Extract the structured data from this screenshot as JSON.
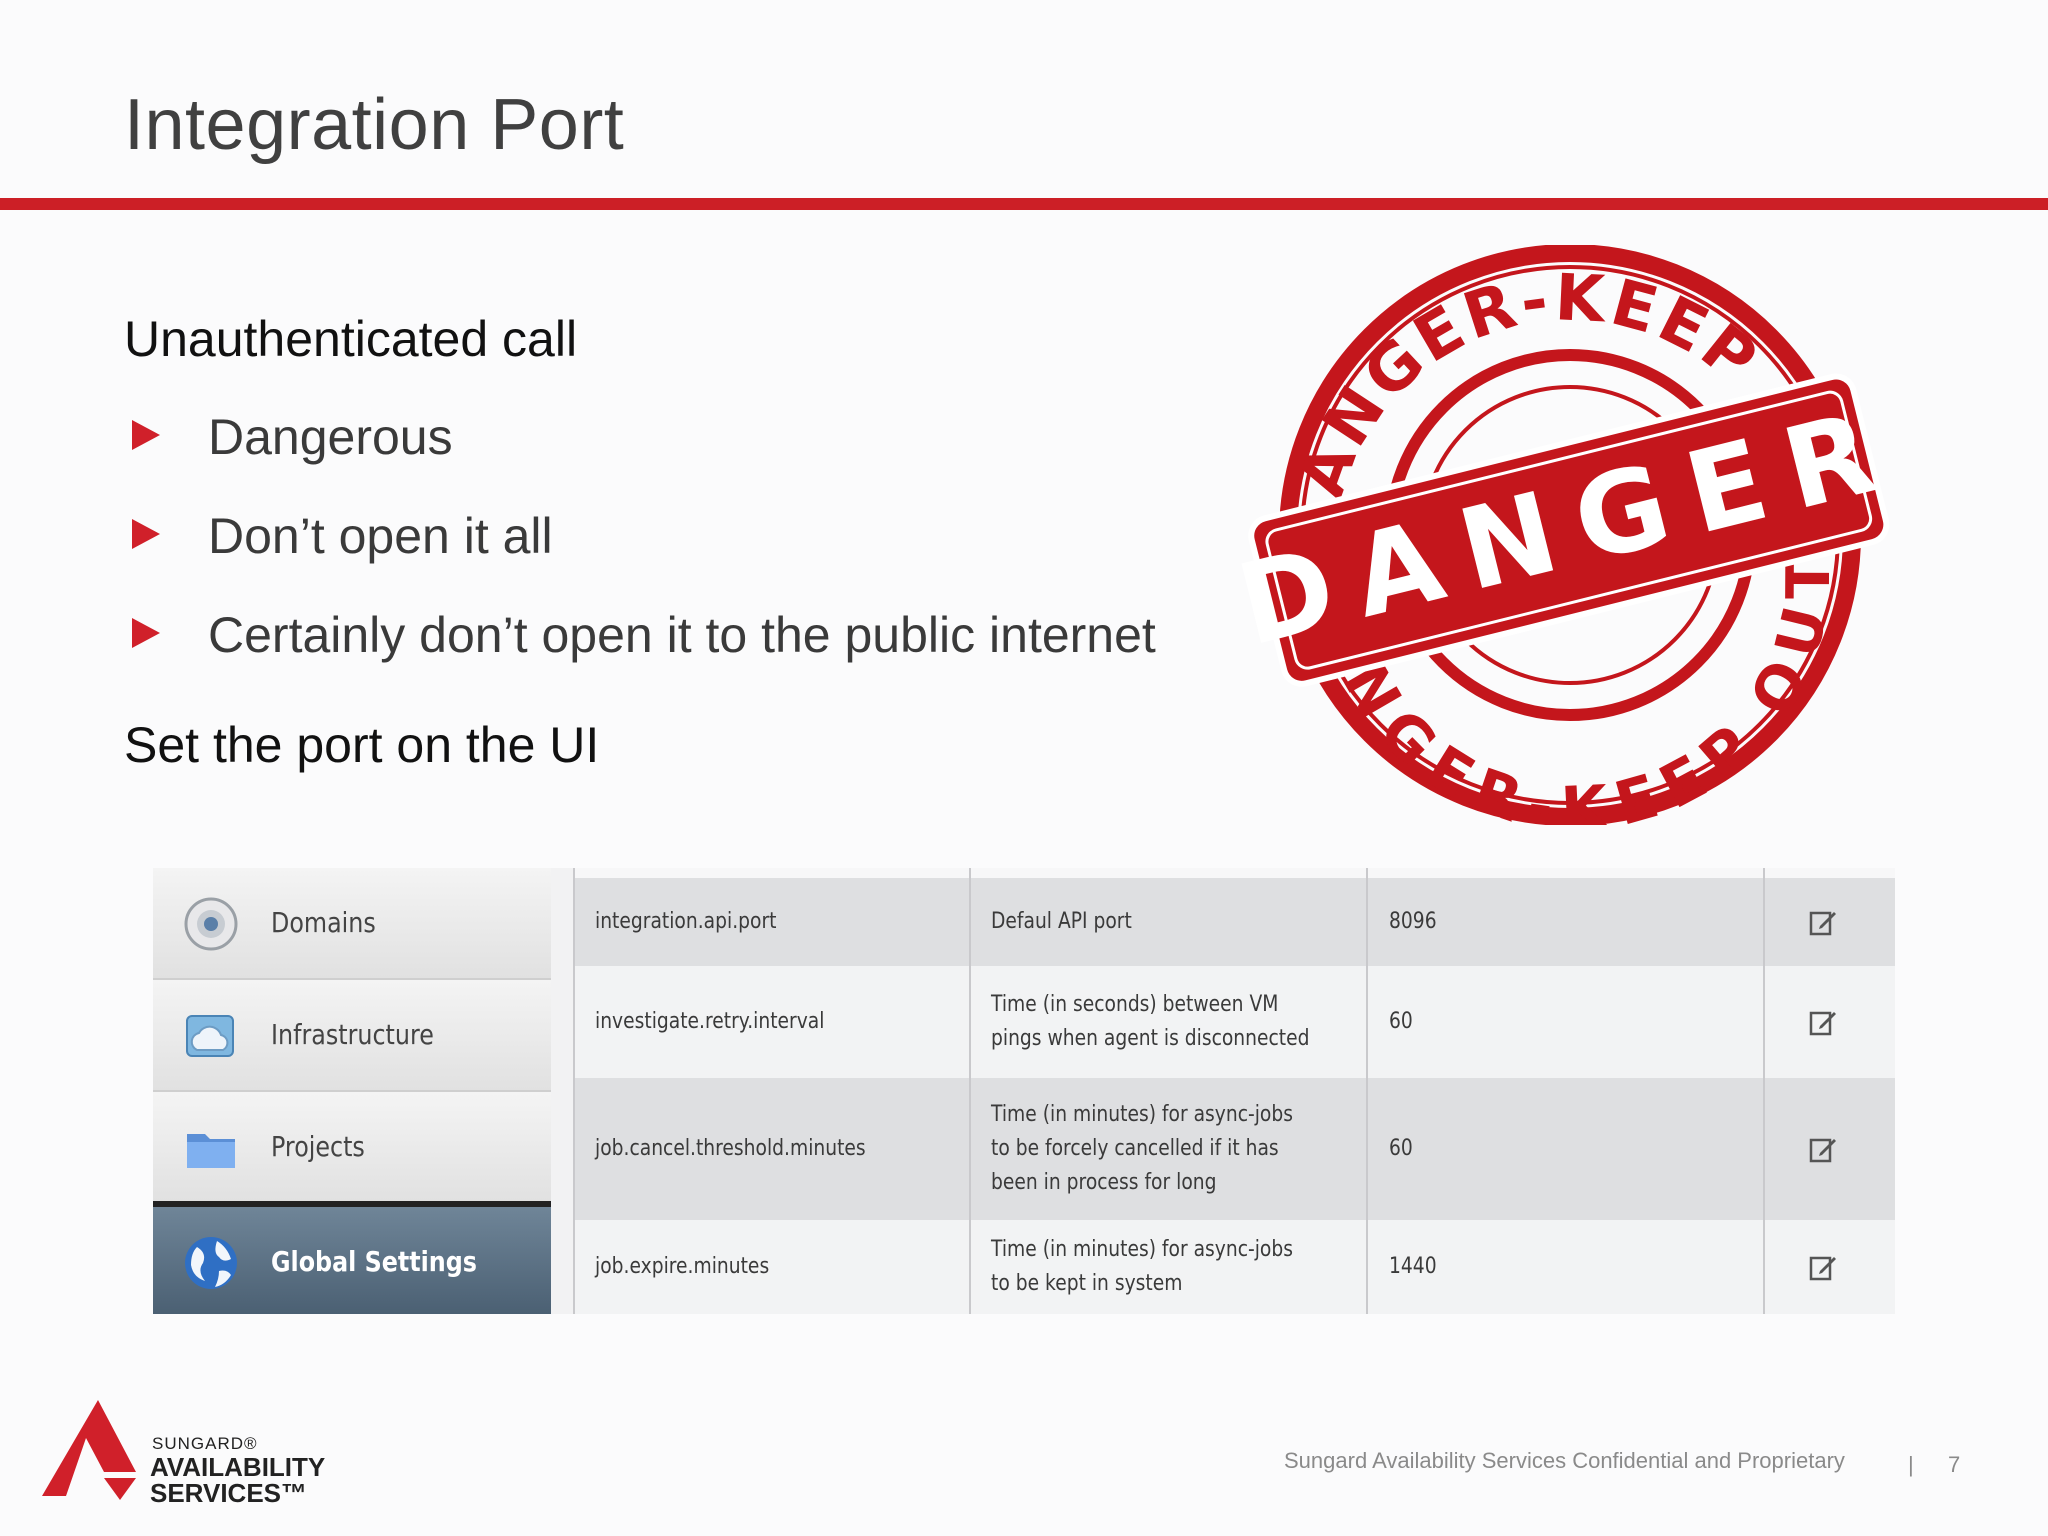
{
  "slide": {
    "title": "Integration Port",
    "heading1": "Unauthenticated call",
    "bullets": [
      "Dangerous",
      "Don’t open it all",
      "Certainly don’t open it to the public internet"
    ],
    "heading2": "Set the port on the UI"
  },
  "stamp": {
    "top_arc": "DANGER-KEEP OUT",
    "bottom_arc": "DANGER-KEEP OUT",
    "banner": "DANGER",
    "color": "#c4161c"
  },
  "settings_ui": {
    "sidebar": [
      {
        "label": "Domains",
        "icon": "domain-icon"
      },
      {
        "label": "Infrastructure",
        "icon": "cloud-icon"
      },
      {
        "label": "Projects",
        "icon": "folder-icon"
      },
      {
        "label": "Global Settings",
        "icon": "globe-icon",
        "active": true
      }
    ],
    "rows": [
      {
        "name": "integration.api.port",
        "description": "Defaul API port",
        "value": "8096"
      },
      {
        "name": "investigate.retry.interval",
        "description": "Time (in seconds) between VM pings when agent is disconnected",
        "value": "60"
      },
      {
        "name": "job.cancel.threshold.minutes",
        "description": "Time (in minutes) for async-jobs to be forcely cancelled if it has been in process for long",
        "value": "60"
      },
      {
        "name": "job.expire.minutes",
        "description": "Time (in minutes) for async-jobs to be kept in system",
        "value": "1440"
      }
    ],
    "edit_icon": "edit-icon"
  },
  "footer": {
    "logo_line1": "SUNGARD®",
    "logo_line2": "AVAILABILITY",
    "logo_line3": "SERVICES™",
    "confidential": "Sungard Availability Services Confidential and Proprietary",
    "separator": "|",
    "page_number": "7"
  },
  "colors": {
    "accent": "#cc1f26",
    "bullet": "#d0202a"
  }
}
